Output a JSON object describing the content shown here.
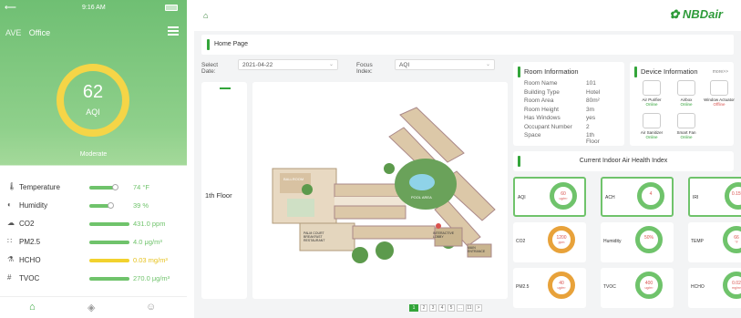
{
  "phone": {
    "status_time": "9:16 AM",
    "brand": "AVE",
    "room": "Office",
    "aqi_value": "62",
    "aqi_label": "AQI",
    "aqi_level": "Moderate",
    "metrics": [
      {
        "name": "Temperature",
        "value": "74 °F",
        "icon": "thermometer-icon",
        "color": "green",
        "fill_pct": 65
      },
      {
        "name": "Humidity",
        "value": "39 %",
        "icon": "humidity-icon",
        "color": "green",
        "fill_pct": 55
      },
      {
        "name": "CO2",
        "value": "431.0 ppm",
        "icon": "co2-icon",
        "color": "green",
        "fill_pct": 100
      },
      {
        "name": "PM2.5",
        "value": "4.0 μg/m³",
        "icon": "pm25-icon",
        "color": "green",
        "fill_pct": 100
      },
      {
        "name": "HCHO",
        "value": "0.03 mg/m³",
        "icon": "hcho-icon",
        "color": "yellow",
        "fill_pct": 100
      },
      {
        "name": "TVOC",
        "value": "270.0 μg/m³",
        "icon": "tvoc-icon",
        "color": "green",
        "fill_pct": 100
      }
    ],
    "tabs": [
      "home-icon",
      "cube-icon",
      "smile-icon"
    ]
  },
  "web": {
    "logo": "NBDair",
    "breadcrumb": "Home Page",
    "select_date_label": "Select Date:",
    "select_date_value": "2021-04-22",
    "focus_index_label": "Focus Index:",
    "focus_index_value": "AQI",
    "floor": "1th Floor",
    "pager": [
      "1",
      "2",
      "3",
      "4",
      "5",
      "...",
      "11",
      ">"
    ],
    "room_info": {
      "title": "Room Information",
      "rows": [
        {
          "k": "Room Name",
          "v": "101"
        },
        {
          "k": "Building Type",
          "v": "Hotel"
        },
        {
          "k": "Room Area",
          "v": "80m²"
        },
        {
          "k": "Room Height",
          "v": "3m"
        },
        {
          "k": "Has Windows",
          "v": "yes"
        },
        {
          "k": "Occupant Number",
          "v": "2"
        },
        {
          "k": "Space",
          "v": "1th Floor"
        }
      ]
    },
    "device_info": {
      "title": "Device Information",
      "more": "more>>",
      "devices": [
        {
          "name": "Air Purifier",
          "status": "Online"
        },
        {
          "name": "Airbox",
          "status": "Online"
        },
        {
          "name": "Window Actuator",
          "status": "Offline"
        },
        {
          "name": "Air Sanitizer",
          "status": "Online"
        },
        {
          "name": "Smart Fan",
          "status": "Online"
        }
      ]
    },
    "health": {
      "title": "Current Indoor Air Health Index",
      "tiles": [
        {
          "name": "AQI",
          "value": "60",
          "unit": "ug/m³"
        },
        {
          "name": "ACH",
          "value": "4",
          "unit": ""
        },
        {
          "name": "IRI",
          "value": "0.15%",
          "unit": ""
        },
        {
          "name": "CO2",
          "value": "1200",
          "unit": "ppm"
        },
        {
          "name": "Humidity",
          "value": "50%",
          "unit": ""
        },
        {
          "name": "TEMP",
          "value": "66",
          "unit": "°F"
        },
        {
          "name": "PM2.5",
          "value": "40",
          "unit": "ug/m³"
        },
        {
          "name": "TVOC",
          "value": "400",
          "unit": "ug/m³"
        },
        {
          "name": "HCHO",
          "value": "0.02",
          "unit": "mg/m³"
        }
      ]
    },
    "map_labels": [
      "BALLROOM",
      "POOL AREA",
      "PALM COURT BREAKFAST RESTAURANT",
      "INTERACTIVE LOBBY",
      "MAIN ENTRANCE"
    ]
  }
}
